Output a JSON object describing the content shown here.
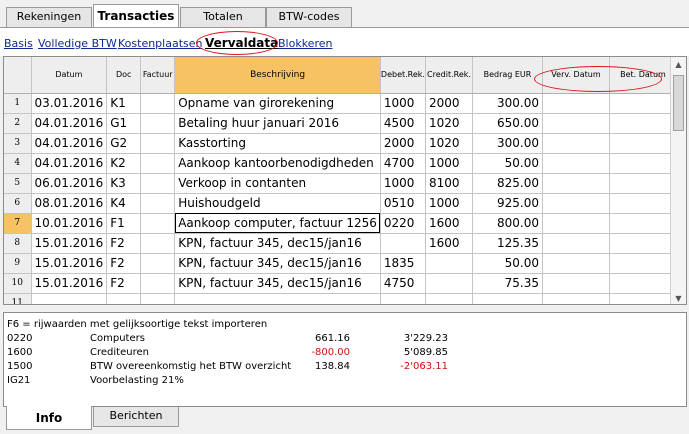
{
  "top_tabs": [
    "Rekeningen",
    "Transacties",
    "Totalen",
    "BTW-codes"
  ],
  "active_top_tab": "Transacties",
  "subviews": [
    "Basis",
    "Volledige BTW",
    "Kostenplaatsen",
    "Vervaldata",
    "Blokkeren"
  ],
  "active_subview": "Vervaldata",
  "table": {
    "columns": [
      "Datum",
      "Doc",
      "Factuur",
      "Beschrijving",
      "Debet.Rek.",
      "Credit.Rek.",
      "Bedrag EUR",
      "Verv. Datum",
      "Bet. Datum"
    ],
    "rows": [
      {
        "n": "1",
        "datum": "03.01.2016",
        "doc": "K1",
        "factuur": "",
        "beschr": "Opname van girorekening",
        "debet": "1000",
        "credit": "2000",
        "bedrag": "300.00"
      },
      {
        "n": "2",
        "datum": "04.01.2016",
        "doc": "G1",
        "factuur": "",
        "beschr": "Betaling huur januari 2016",
        "debet": "4500",
        "credit": "1020",
        "bedrag": "650.00"
      },
      {
        "n": "3",
        "datum": "04.01.2016",
        "doc": "G2",
        "factuur": "",
        "beschr": "Kasstorting",
        "debet": "2000",
        "credit": "1020",
        "bedrag": "300.00"
      },
      {
        "n": "4",
        "datum": "04.01.2016",
        "doc": "K2",
        "factuur": "",
        "beschr": "Aankoop kantoorbenodigdheden",
        "debet": "4700",
        "credit": "1000",
        "bedrag": "50.00"
      },
      {
        "n": "5",
        "datum": "06.01.2016",
        "doc": "K3",
        "factuur": "",
        "beschr": "Verkoop in contanten",
        "debet": "1000",
        "credit": "8100",
        "bedrag": "825.00"
      },
      {
        "n": "6",
        "datum": "08.01.2016",
        "doc": "K4",
        "factuur": "",
        "beschr": "Huishoudgeld",
        "debet": "0510",
        "credit": "1000",
        "bedrag": "925.00"
      },
      {
        "n": "7",
        "datum": "10.01.2016",
        "doc": "F1",
        "factuur": "",
        "beschr": "Aankoop computer, factuur 1256",
        "debet": "0220",
        "credit": "1600",
        "bedrag": "800.00"
      },
      {
        "n": "8",
        "datum": "15.01.2016",
        "doc": "F2",
        "factuur": "",
        "beschr": "KPN, factuur 345, dec15/jan16",
        "debet": "",
        "credit": "1600",
        "bedrag": "125.35"
      },
      {
        "n": "9",
        "datum": "15.01.2016",
        "doc": "F2",
        "factuur": "",
        "beschr": "KPN, factuur 345, dec15/jan16",
        "debet": "1835",
        "credit": "",
        "bedrag": "50.00"
      },
      {
        "n": "10",
        "datum": "15.01.2016",
        "doc": "F2",
        "factuur": "",
        "beschr": "KPN, factuur 345, dec15/jan16",
        "debet": "4750",
        "credit": "",
        "bedrag": "75.35"
      },
      {
        "n": "11",
        "datum": "",
        "doc": "",
        "factuur": "",
        "beschr": "",
        "debet": "",
        "credit": "",
        "bedrag": ""
      }
    ]
  },
  "info": {
    "hint": "F6 = rijwaarden met gelijksoortige tekst importeren",
    "lines": [
      {
        "code": "0220",
        "desc": "Computers",
        "amount": "661.16",
        "total": "3'229.23"
      },
      {
        "code": "1600",
        "desc": "Crediteuren",
        "amount": "-800.00",
        "total": "5'089.85"
      },
      {
        "code": "1500",
        "desc": "BTW overeenkomstig het BTW overzicht",
        "amount": "138.84",
        "total": "-2'063.11"
      },
      {
        "code": "IG21",
        "desc": "Voorbelasting 21%",
        "amount": "",
        "total": ""
      }
    ]
  },
  "bottom_tabs": [
    "Info",
    "Berichten"
  ],
  "active_bottom_tab": "Info",
  "colors": {
    "highlight_orange": "#f6c264",
    "annotation_red": "#e0141c",
    "negative": "#d01010",
    "link_blue": "#0b2a8f"
  }
}
